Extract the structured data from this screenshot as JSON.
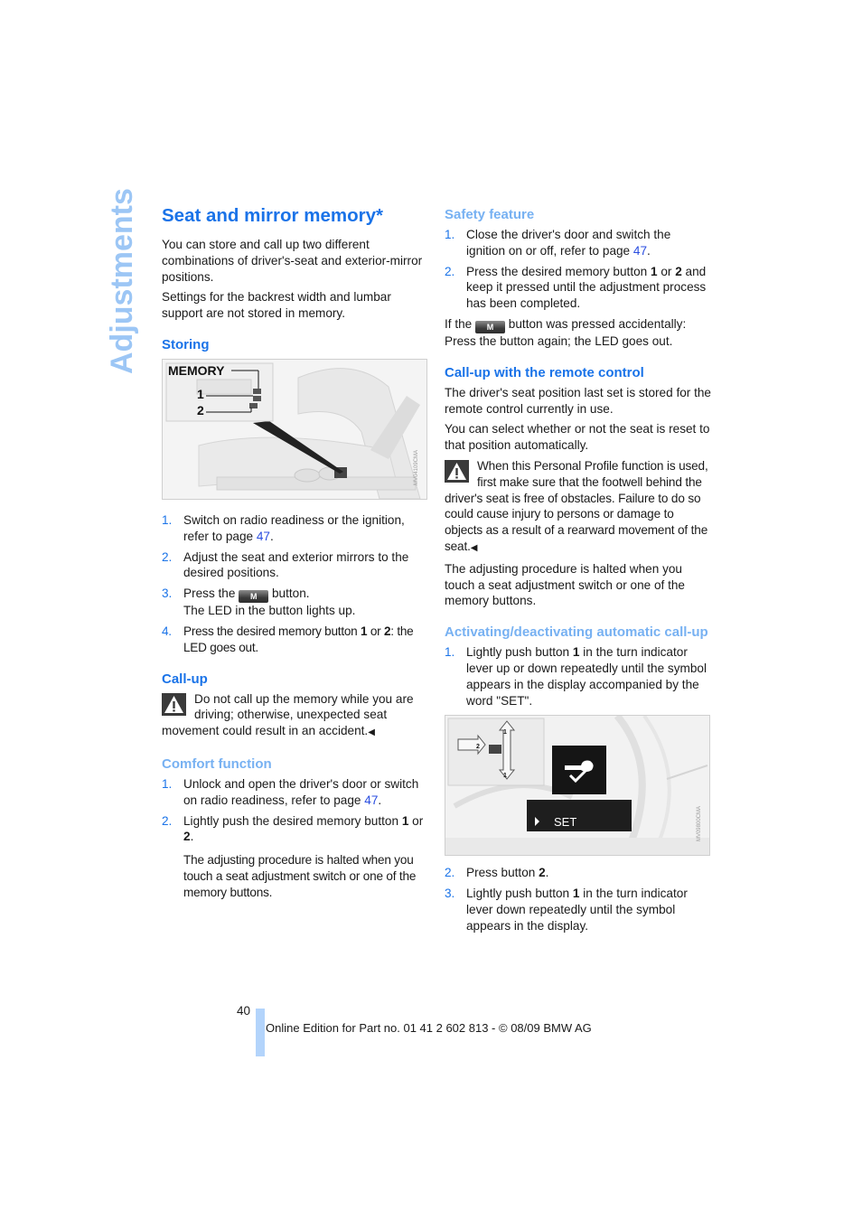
{
  "side_tab": {
    "label": "Adjustments"
  },
  "left": {
    "title": "Seat and mirror memory*",
    "intro": [
      "You can store and call up two different combinations of driver's-seat and exterior-mirror positions.",
      "Settings for the backrest width and lumbar support are not stored in memory."
    ],
    "storing": {
      "heading": "Storing",
      "figure": {
        "label_memory": "MEMORY",
        "label_1": "1",
        "label_2": "2",
        "figure_id": "MV04109CMA"
      },
      "steps": [
        {
          "num": "1.",
          "text_a": "Switch on radio readiness or the ignition, refer to page ",
          "link": "47",
          "text_b": "."
        },
        {
          "num": "2.",
          "text": "Adjust the seat and exterior mirrors to the desired positions."
        },
        {
          "num": "3.",
          "text_a": "Press the ",
          "button": "M",
          "text_b": " button.",
          "text_c": "The LED in the button lights up."
        },
        {
          "num": "4.",
          "text_a": "Press the desired memory button ",
          "bold_1": "1",
          "text_b": " or ",
          "bold_2": "2",
          "text_c": ": the LED goes out."
        }
      ]
    },
    "callup": {
      "heading": "Call-up",
      "warning": "Do not call up the memory while you are driving; otherwise, unexpected seat movement could result in an accident.",
      "end_mark": "◀"
    },
    "comfort": {
      "heading": "Comfort function",
      "steps": [
        {
          "num": "1.",
          "text_a": "Unlock and open the driver's door or switch on radio readiness, refer to page ",
          "link": "47",
          "text_b": "."
        },
        {
          "num": "2.",
          "text_a": "Lightly push the desired memory button ",
          "bold_1": "1",
          "text_b": " or ",
          "bold_2": "2",
          "text_c": "."
        }
      ],
      "note": "The adjusting procedure is halted when you touch a seat adjustment switch or one of the memory buttons."
    }
  },
  "right": {
    "safety": {
      "heading": "Safety feature",
      "steps": [
        {
          "num": "1.",
          "text_a": "Close the driver's door and switch the ignition on or off, refer to page ",
          "link": "47",
          "text_b": "."
        },
        {
          "num": "2.",
          "text_a": "Press the desired memory button ",
          "bold_1": "1",
          "text_b": " or ",
          "bold_2": "2",
          "text_c": " and keep it pressed until the adjustment process has been completed."
        }
      ],
      "note_a": "If the ",
      "note_button": "M",
      "note_b": " button was pressed accidentally: Press the button again; the LED goes out."
    },
    "remote": {
      "heading": "Call-up with the remote control",
      "paragraphs": [
        "The driver's seat position last set is stored for the remote control currently in use.",
        "You can select whether or not the seat is reset to that position automatically."
      ],
      "warning": "When this Personal Profile function is used, first make sure that the footwell behind the driver's seat is free of obstacles. Failure to do so could cause injury to persons or damage to objects as a result of a rearward movement of the seat.",
      "end_mark": "◀",
      "note": "The adjusting procedure is halted when you touch a seat adjustment switch or one of the memory buttons."
    },
    "auto": {
      "heading": "Activating/deactivating automatic call-up",
      "step1": {
        "num": "1.",
        "text_a": "Lightly push button ",
        "bold": "1",
        "text_b": " in the turn indicator lever up or down repeatedly until the symbol appears in the display accompanied by the word \"SET\"."
      },
      "figure": {
        "display_text": "SET",
        "lever_label_1": "1",
        "lever_label_2": "2",
        "figure_id": "MV09800CMA"
      },
      "step2": {
        "num": "2.",
        "text_a": "Press button ",
        "bold": "2",
        "text_b": "."
      },
      "step3": {
        "num": "3.",
        "text_a": "Lightly push button ",
        "bold": "1",
        "text_b": " in the turn indicator lever down repeatedly until the symbol appears in the display."
      }
    }
  },
  "footer": {
    "page_number": "40",
    "text": "Online Edition for Part no. 01 41 2 602 813 - © 08/09 BMW AG"
  },
  "colors": {
    "heading": "#1a73e8",
    "subheading_light": "#77b1f2",
    "side_tab": "#9cc6f5",
    "link": "#2a4ee0",
    "footer_bar": "#b3d4fb"
  }
}
